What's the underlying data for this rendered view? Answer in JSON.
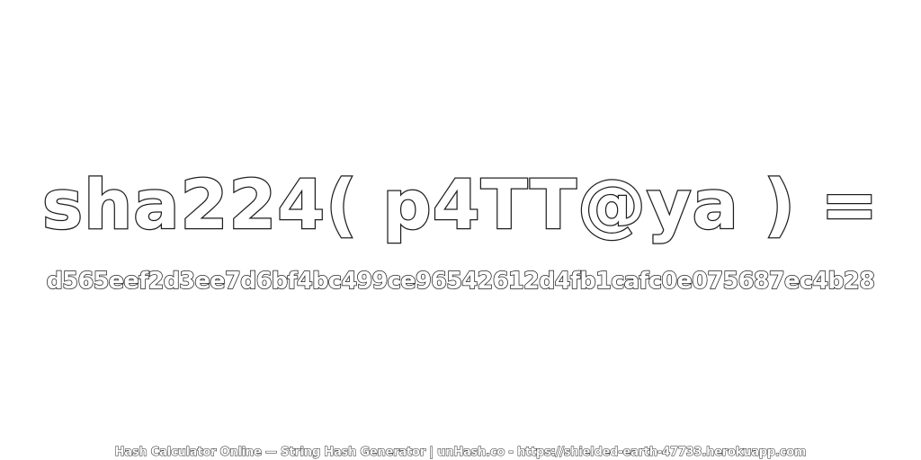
{
  "expression": "sha224( p4TT@ya ) =",
  "hash": "d565eef2d3ee7d6bf4bc499ce96542612d4fb1cafc0e075687ec4b28",
  "footer": "Hash Calculator Online — String Hash Generator | unHash.co - https://shielded-earth-47733.herokuapp.com",
  "colors": {
    "background": "#ffffff",
    "text_fill": "#ffffff",
    "text_outline": "#1e1e1e"
  }
}
